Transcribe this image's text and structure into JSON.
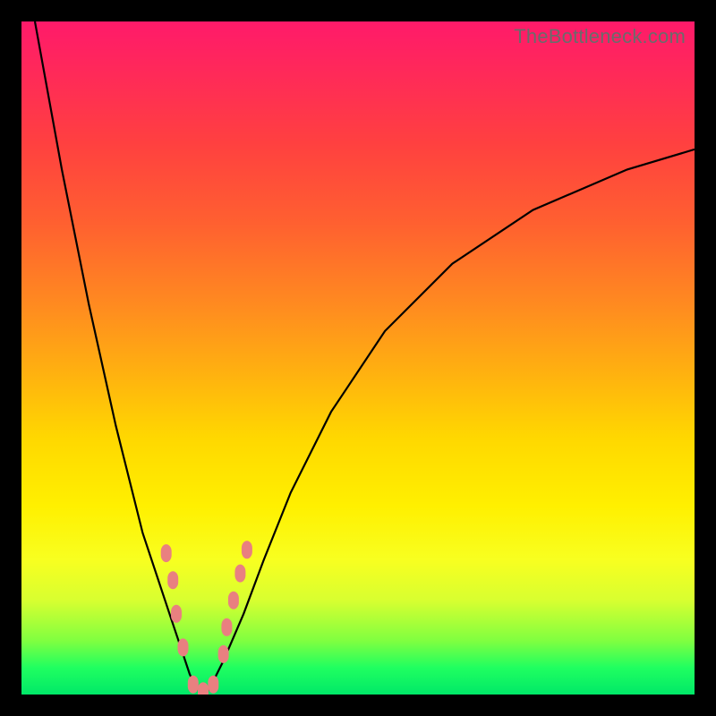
{
  "watermark": {
    "text": "TheBottleneck.com"
  },
  "colors": {
    "curve_stroke": "#000000",
    "marker_fill": "#e98080",
    "marker_stroke": "#e98080"
  },
  "chart_data": {
    "type": "line",
    "title": "",
    "xlabel": "",
    "ylabel": "",
    "xlim": [
      0,
      100
    ],
    "ylim": [
      0,
      100
    ],
    "grid": false,
    "series": [
      {
        "name": "left-branch",
        "x": [
          2,
          6,
          10,
          14,
          18,
          20,
          22,
          24,
          25,
          26,
          27
        ],
        "y": [
          100,
          78,
          58,
          40,
          24,
          18,
          12,
          6,
          3,
          1,
          0
        ]
      },
      {
        "name": "right-branch",
        "x": [
          27,
          28,
          30,
          33,
          36,
          40,
          46,
          54,
          64,
          76,
          90,
          100
        ],
        "y": [
          0,
          1,
          5,
          12,
          20,
          30,
          42,
          54,
          64,
          72,
          78,
          81
        ]
      }
    ],
    "markers": {
      "name": "highlighted-points",
      "x_approx": [
        21.5,
        22.5,
        23.0,
        24.0,
        25.5,
        27.0,
        28.5,
        30.0,
        30.5,
        31.5,
        32.5,
        33.5
      ],
      "y_approx": [
        21.0,
        17.0,
        12.0,
        7.0,
        1.5,
        0.5,
        1.5,
        6.0,
        10.0,
        14.0,
        18.0,
        21.5
      ]
    }
  }
}
